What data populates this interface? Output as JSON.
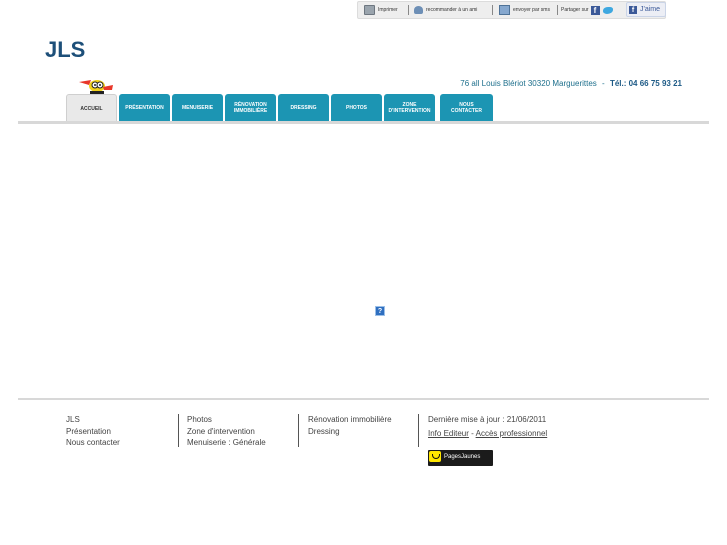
{
  "topbar": {
    "print_label": "Imprimer",
    "recommend_label": "recommander à un ami",
    "send_label": "envoyer par sms",
    "share_label": "Partager sur",
    "like_label": "J'aime"
  },
  "header": {
    "logo": "JLS",
    "address": "76 all Louis Blériot 30320 Marguerittes",
    "phone_separator": "-",
    "phone": "Tél.: 04 66 75 93 21"
  },
  "nav": {
    "tabs": [
      {
        "label": "Accueil"
      },
      {
        "label": "Présentation"
      },
      {
        "label": "Menuiserie"
      },
      {
        "label": "Rénovation immobilière"
      },
      {
        "label": "Dressing"
      },
      {
        "label": "Photos"
      },
      {
        "label": "Zone d'intervention"
      },
      {
        "label": "Nous contacter"
      }
    ]
  },
  "main": {
    "missing_plugin": "?"
  },
  "footer": {
    "col1": [
      "JLS",
      "Présentation",
      "Nous contacter"
    ],
    "col2": [
      "Photos",
      "Zone d'intervention",
      "Menuiserie : Générale"
    ],
    "col3": [
      "Rénovation immobilière",
      "Dressing"
    ],
    "updated": "Dernière mise à jour : 21/06/2011",
    "info_editor": "Info Editeur",
    "link_separator": "-",
    "pro_access": "Accès professionnel",
    "pagesjaunes": "PagesJaunes"
  },
  "colors": {
    "brand": "#1d4f79",
    "tab": "#1c95b3",
    "active_tab": "#e9e9e9"
  }
}
